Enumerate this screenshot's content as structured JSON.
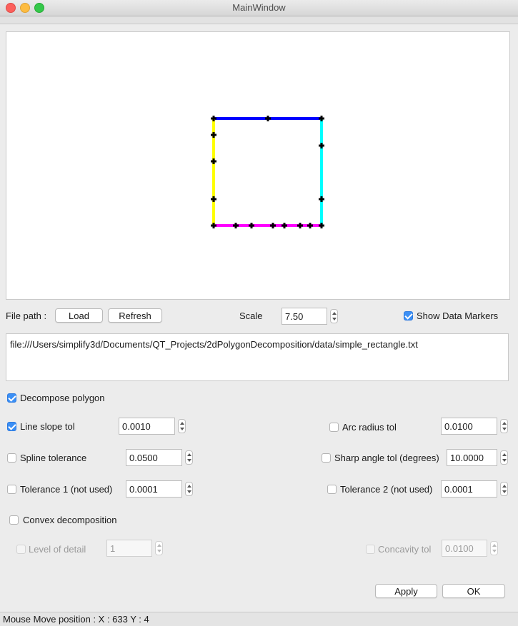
{
  "window": {
    "title": "MainWindow"
  },
  "canvas": {
    "polygon_edges": [
      {
        "side": "top",
        "color": "#0000ff"
      },
      {
        "side": "right",
        "color": "#00ffff"
      },
      {
        "side": "bottom",
        "color": "#ff00ff"
      },
      {
        "side": "left",
        "color": "#ffff00"
      }
    ],
    "marker_color": "#000000"
  },
  "file_row": {
    "file_path_label": "File path :",
    "load_label": "Load",
    "refresh_label": "Refresh",
    "scale_label": "Scale",
    "scale_value": "7.50",
    "show_markers_label": "Show Data Markers",
    "show_markers_checked": true
  },
  "path_text": "file:///Users/simplify3d/Documents/QT_Projects/2dPolygonDecomposition/data/simple_rectangle.txt",
  "decompose": {
    "label": "Decompose polygon",
    "checked": true
  },
  "params": {
    "line_slope": {
      "label": "Line slope tol",
      "value": "0.0010",
      "checked": true
    },
    "arc_radius": {
      "label": "Arc radius tol",
      "value": "0.0100",
      "checked": false
    },
    "spline": {
      "label": "Spline tolerance",
      "value": "0.0500",
      "checked": false
    },
    "sharp_angle": {
      "label": "Sharp angle tol (degrees)",
      "value": "10.0000",
      "checked": false
    },
    "tol1": {
      "label": "Tolerance 1 (not used)",
      "value": "0.0001",
      "checked": false
    },
    "tol2": {
      "label": "Tolerance 2 (not used)",
      "value": "0.0001",
      "checked": false
    }
  },
  "convex": {
    "label": "Convex decomposition",
    "checked": false,
    "level_label": "Level of detail",
    "level_value": "1",
    "concavity_label": "Concavity tol",
    "concavity_value": "0.0100"
  },
  "buttons": {
    "apply_label": "Apply",
    "ok_label": "OK"
  },
  "status": {
    "text": "Mouse Move position : X : 633 Y : 4"
  }
}
